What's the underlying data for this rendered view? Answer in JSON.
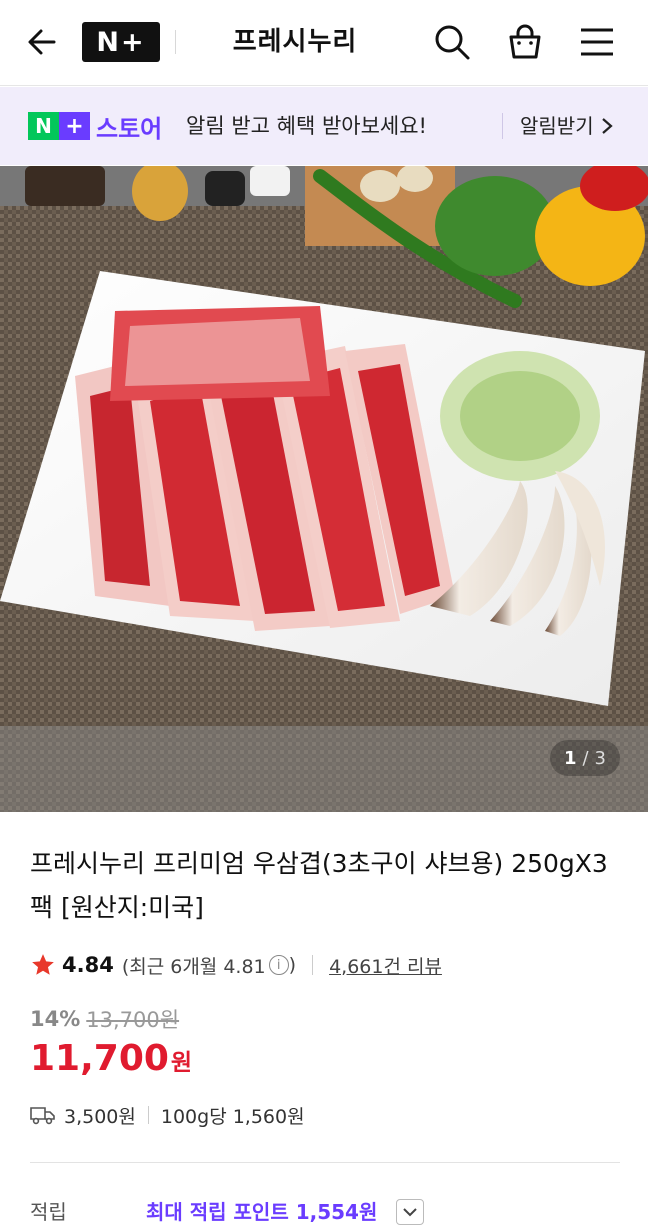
{
  "header": {
    "logo_text": "N+",
    "title": "프레시누리",
    "icons": [
      "back-arrow-icon",
      "search-icon",
      "shopping-bag-icon",
      "menu-icon"
    ]
  },
  "banner": {
    "logo_n": "N",
    "logo_plus": "+",
    "store_label": "스토어",
    "message": "알림 받고 혜택 받아보세요!",
    "action_label": "알림받기"
  },
  "gallery": {
    "current": "1",
    "separator": "/",
    "total": "3"
  },
  "product": {
    "title": "프레시누리 프리미엄 우삼겹(3초구이 샤브용) 250gX3팩 [원산지:미국]",
    "rating": "4.84",
    "recent_rating_prefix": "(최근 6개월 4.81",
    "recent_rating_suffix": ")",
    "info_icon": "i",
    "review_link": "4,661건 리뷰",
    "discount_rate": "14%",
    "original_price": "13,700원",
    "sale_price": "11,700",
    "sale_unit": "원",
    "shipping_fee": "3,500원",
    "unit_price": "100g당 1,560원",
    "points_label": "적립",
    "points_value": "최대 적립 포인트 1,554원"
  },
  "colors": {
    "naver_green": "#03c75a",
    "naver_purple": "#6a3cff",
    "sale_red": "#e01b2f",
    "banner_bg": "#f1edfb",
    "star": "#e8382b"
  }
}
